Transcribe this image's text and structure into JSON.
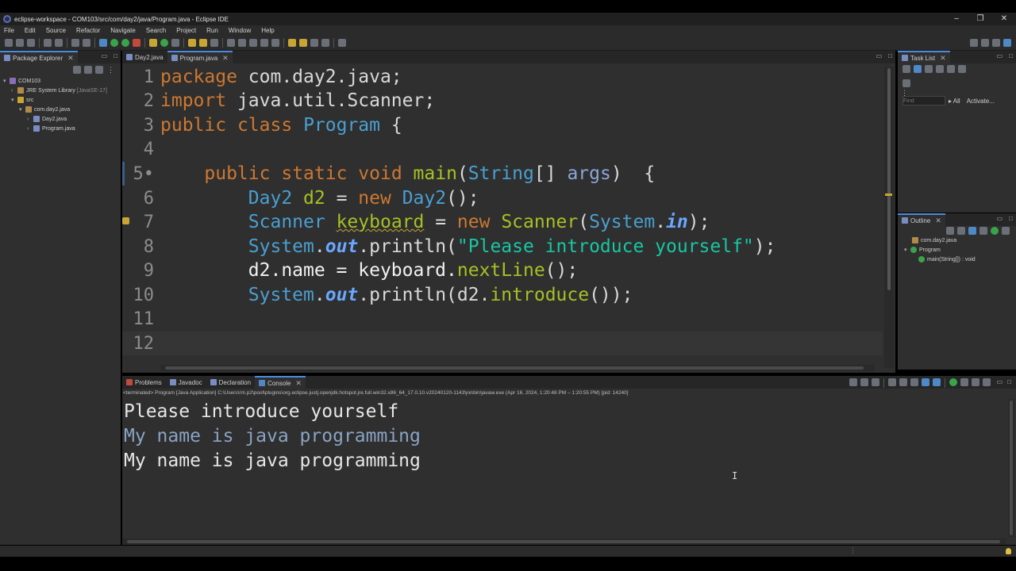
{
  "window": {
    "title": "eclipse-workspace - COM103/src/com/day2/java/Program.java - Eclipse IDE",
    "minimize": "–",
    "maximize": "❐",
    "close": "✕"
  },
  "menu": [
    "File",
    "Edit",
    "Source",
    "Refactor",
    "Navigate",
    "Search",
    "Project",
    "Run",
    "Window",
    "Help"
  ],
  "package_explorer": {
    "tab": "Package Explorer",
    "tree": [
      {
        "label": "COM103",
        "suffix": "",
        "arrow": "▾"
      },
      {
        "label": "JRE System Library",
        "suffix": "[JavaSE-17]",
        "arrow": "›"
      },
      {
        "label": "src",
        "suffix": "",
        "arrow": "▾"
      },
      {
        "label": "com.day2.java",
        "suffix": "",
        "arrow": "▾"
      },
      {
        "label": "Day2.java",
        "suffix": "",
        "arrow": "›"
      },
      {
        "label": "Program.java",
        "suffix": "",
        "arrow": "›"
      }
    ]
  },
  "editor": {
    "tabs": [
      {
        "label": "Day2.java",
        "active": false
      },
      {
        "label": "Program.java",
        "active": true
      }
    ],
    "lines": [
      {
        "n": "1"
      },
      {
        "n": "2"
      },
      {
        "n": "3"
      },
      {
        "n": "4"
      },
      {
        "n": "5•"
      },
      {
        "n": "6"
      },
      {
        "n": "7"
      },
      {
        "n": "8"
      },
      {
        "n": "9"
      },
      {
        "n": "10"
      },
      {
        "n": "11"
      },
      {
        "n": "12"
      }
    ],
    "code": {
      "l1": [
        "package",
        " com.day2.java;"
      ],
      "l2": [
        "import",
        " java.util.Scanner;"
      ],
      "l3": [
        "public",
        " ",
        "class",
        " ",
        "Program",
        " {"
      ],
      "l5": [
        "    ",
        "public",
        " ",
        "static",
        " ",
        "void",
        " ",
        "main",
        "(",
        "String",
        "[] ",
        "args",
        ")  {"
      ],
      "l6": [
        "        ",
        "Day2",
        " ",
        "d2",
        " = ",
        "new",
        " ",
        "Day2",
        "();"
      ],
      "l7": [
        "        ",
        "Scanner",
        " ",
        "keyboard",
        " = ",
        "new",
        " ",
        "Scanner",
        "(",
        "System",
        ".",
        "in",
        ");"
      ],
      "l8": [
        "        ",
        "System",
        ".",
        "out",
        ".println(",
        "\"Please introduce yourself\"",
        ");"
      ],
      "l9": [
        "        ",
        "d2.name = keyboard.",
        "nextLine",
        "();"
      ],
      "l10": [
        "        ",
        "System",
        ".",
        "out",
        ".println(d2.",
        "introduce",
        "());"
      ]
    }
  },
  "task_list": {
    "tab": "Task List",
    "find_placeholder": "Find",
    "all": "▸ All",
    "activate": "Activate..."
  },
  "outline": {
    "tab": "Outline",
    "items": [
      {
        "label": "com.day2.java"
      },
      {
        "label": "Program"
      },
      {
        "label": "main(String[]) : void"
      }
    ]
  },
  "bottom": {
    "tabs": [
      {
        "label": "Problems",
        "active": false
      },
      {
        "label": "Javadoc",
        "active": false
      },
      {
        "label": "Declaration",
        "active": false
      },
      {
        "label": "Console",
        "active": true
      }
    ],
    "status": "<terminated> Program [Java Application] C:\\Users\\rn\\.p2\\pool\\plugins\\org.eclipse.justj.openjdk.hotspot.jre.full.win32.x86_64_17.0.10.v20240120-1143\\jre\\bin\\javaw.exe  (Apr 16, 2024, 1:20:48 PM – 1:20:55 PM) [pid: 14240]",
    "output": [
      {
        "text": "Please introduce yourself",
        "color": "#e6e6e6"
      },
      {
        "text": "My name is java programming",
        "color": "#8aa3c4"
      },
      {
        "text": "My name is java programming",
        "color": "#e6e6e6"
      }
    ]
  },
  "colors": {
    "keyword": "#cc7832",
    "type": "#4a9fd1",
    "method": "#a8c023",
    "string": "#17c6a3",
    "accent": "#4b8be0"
  }
}
